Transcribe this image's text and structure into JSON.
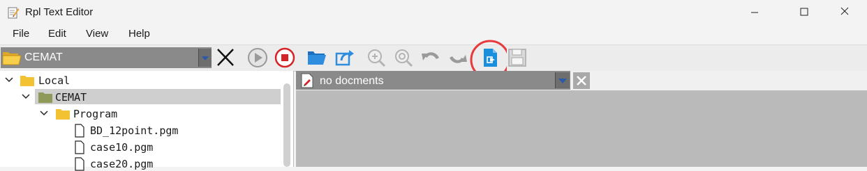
{
  "window": {
    "title": "Rpl Text Editor",
    "controls": [
      "minimize",
      "maximize",
      "close"
    ]
  },
  "menu": {
    "items": [
      "File",
      "Edit",
      "View",
      "Help"
    ]
  },
  "toolbar": {
    "project_selector": {
      "value": "CEMAT"
    },
    "buttons": [
      "close-project-icon",
      "run-icon",
      "stop-icon",
      "open-folder-icon",
      "export-icon",
      "zoom-in-icon",
      "zoom-reset-icon",
      "undo-icon",
      "redo-icon",
      "new-document-icon",
      "save-icon"
    ],
    "highlighted_button": "new-document-icon"
  },
  "tree": {
    "items": [
      {
        "label": "Local",
        "type": "folder",
        "expanded": true
      },
      {
        "label": "CEMAT",
        "type": "folder",
        "expanded": true,
        "selected": true
      },
      {
        "label": "Program",
        "type": "folder",
        "expanded": true
      },
      {
        "label": "BD_12point.pgm",
        "type": "file"
      },
      {
        "label": "case10.pgm",
        "type": "file"
      },
      {
        "label": "case20.pgm",
        "type": "file"
      }
    ]
  },
  "document_selector": {
    "value": "no docments"
  },
  "colors": {
    "folder_yellow": "#f3c233",
    "folder_olive": "#8f9a59",
    "stop_red": "#d4242a",
    "highlight_circle": "#e5393d",
    "blue_icon": "#1a8fdc"
  }
}
